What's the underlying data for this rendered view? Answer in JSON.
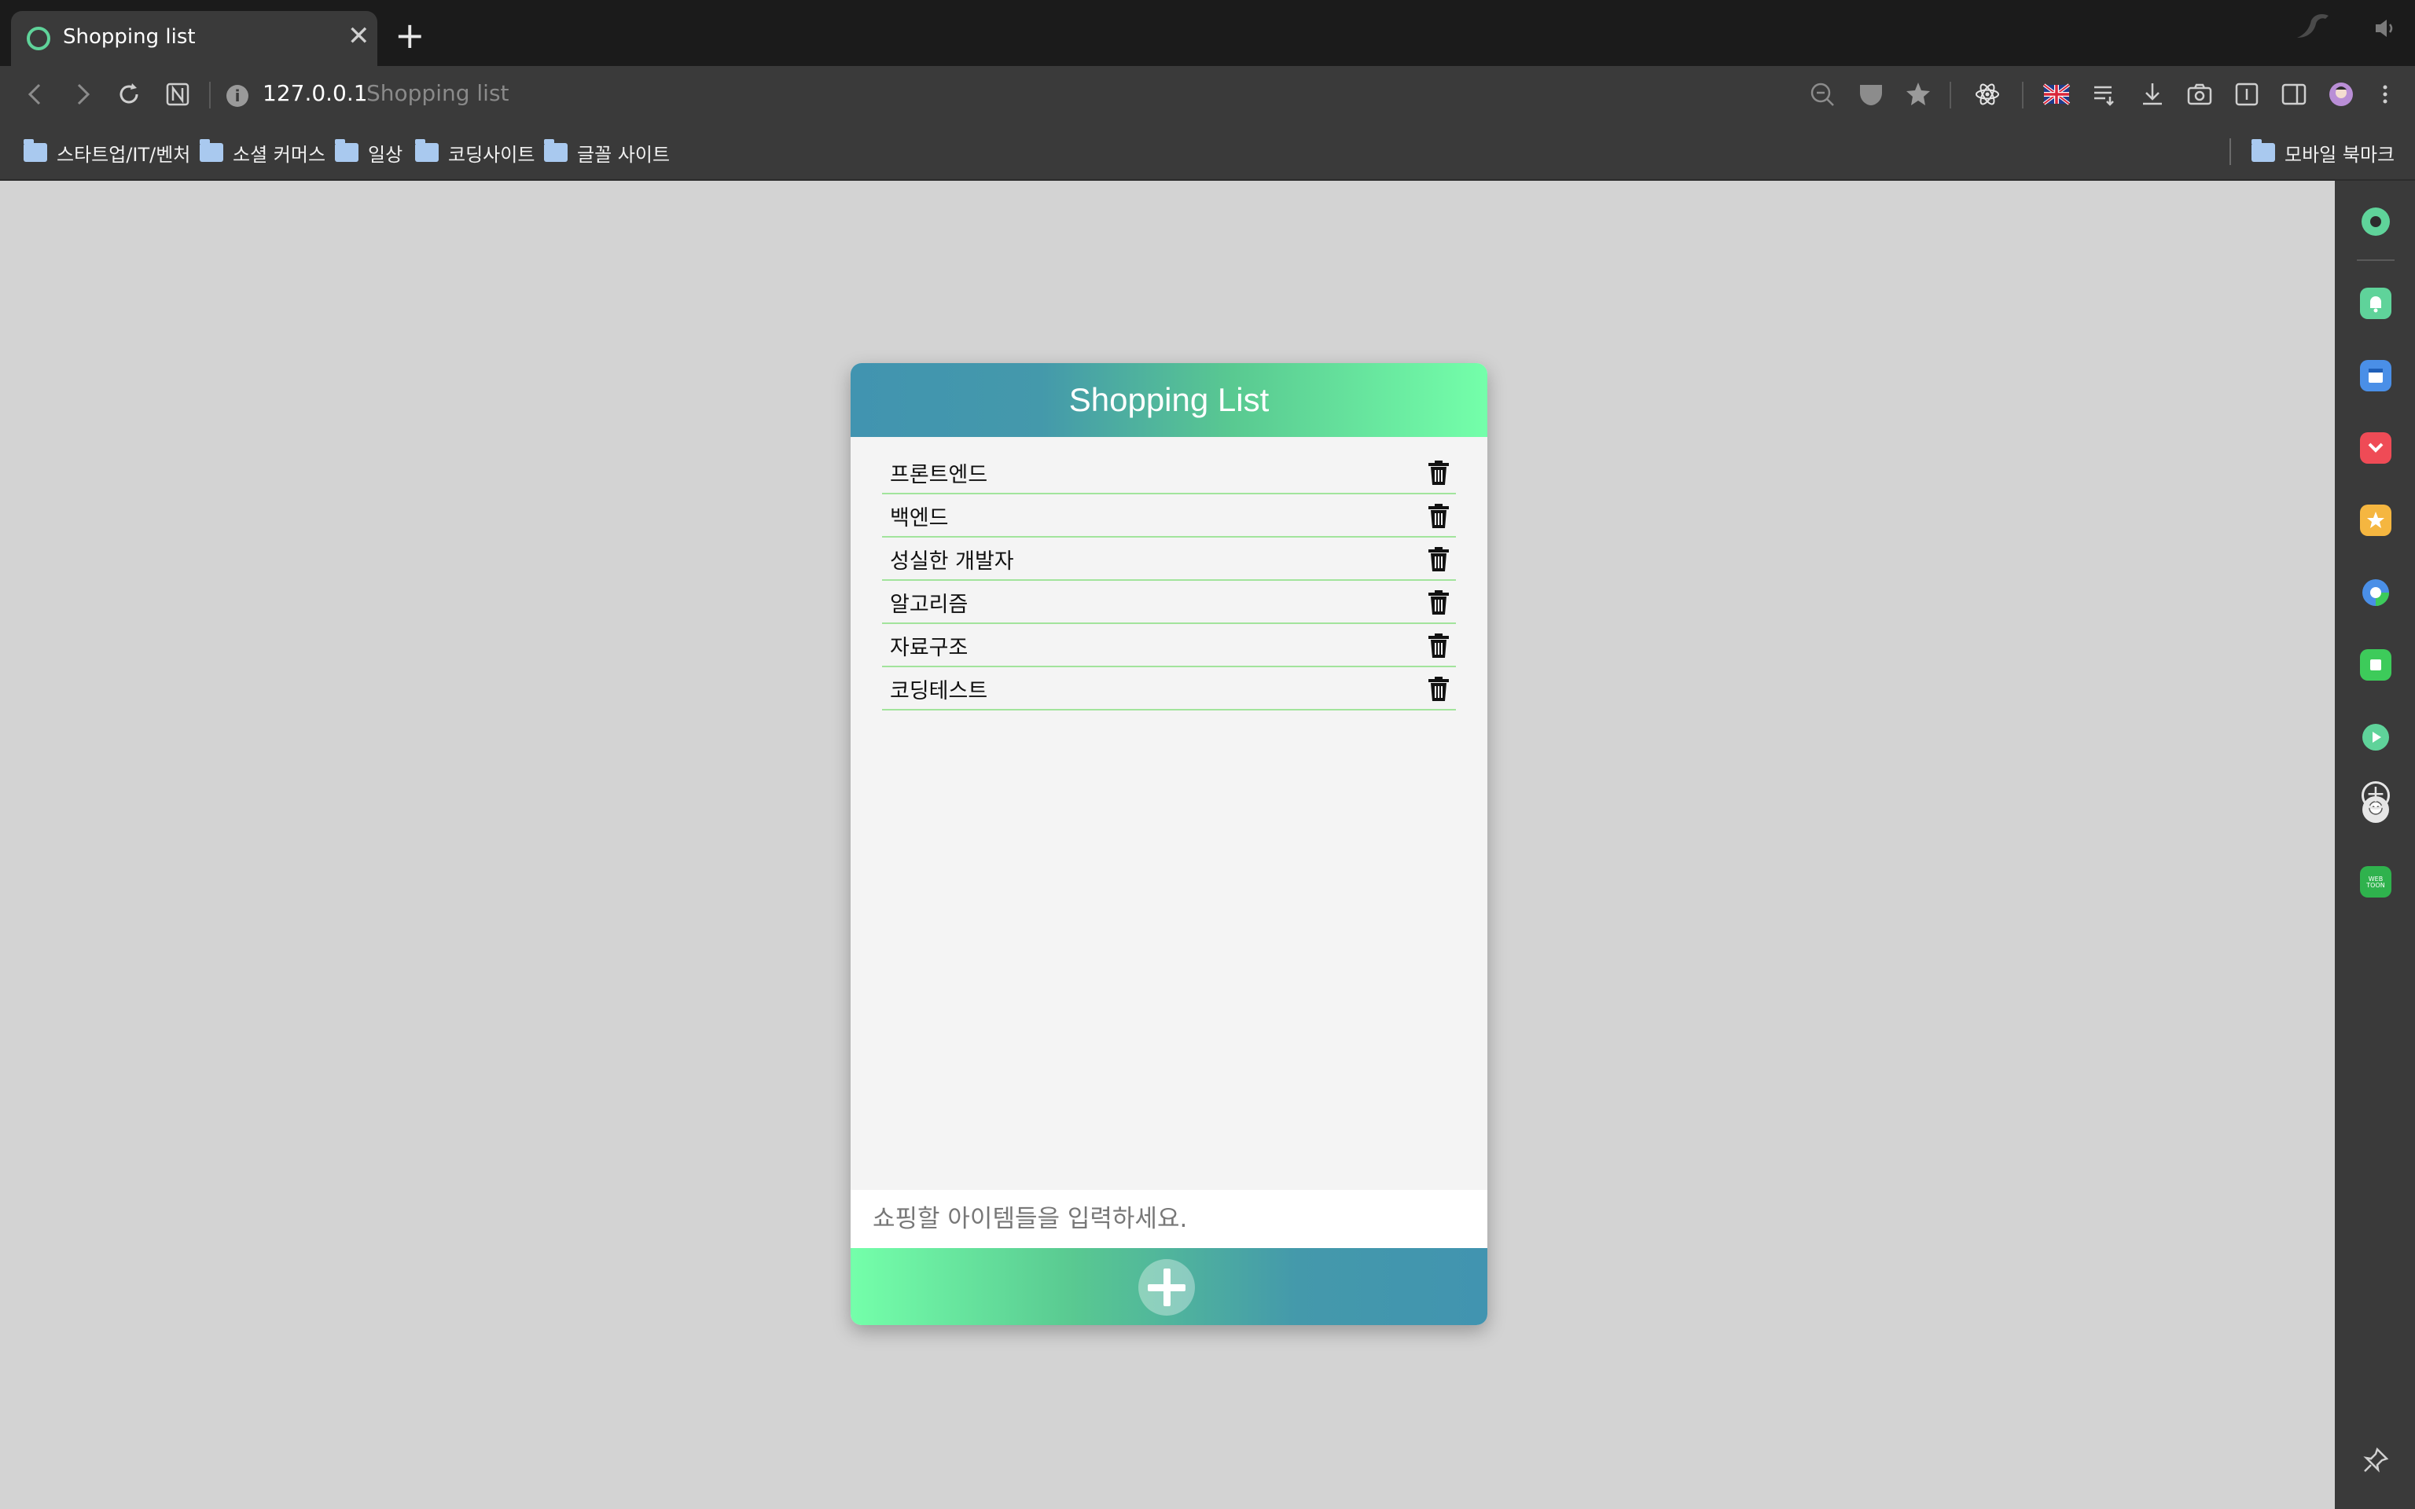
{
  "browser": {
    "tab": {
      "title": "Shopping list",
      "close_glyph": "✕"
    },
    "new_tab_glyph": "+",
    "address": {
      "url": "127.0.0.1",
      "page_title": "Shopping list",
      "info_glyph": "i"
    },
    "bookmarks": [
      {
        "label": "스타트업/IT/벤처"
      },
      {
        "label": "소셜 커머스"
      },
      {
        "label": "일상"
      },
      {
        "label": "코딩사이트"
      },
      {
        "label": "글꼴 사이트"
      }
    ],
    "bookmarks_right": {
      "label": "모바일 북마크"
    }
  },
  "sidebar": {
    "icons": [
      {
        "name": "sidebar-green-circle-icon",
        "color": "#5fd39a"
      },
      {
        "name": "sidebar-notification-icon",
        "color": "#5fd39a"
      },
      {
        "name": "sidebar-calendar-icon",
        "color": "#4a8fe7"
      },
      {
        "name": "sidebar-pocket-icon",
        "color": "#ef4b56"
      },
      {
        "name": "sidebar-star-icon",
        "color": "#f5b640"
      },
      {
        "name": "sidebar-chrome-icon",
        "color": "#4a8fe7"
      },
      {
        "name": "sidebar-green-square-icon",
        "color": "#3dcb5a"
      },
      {
        "name": "sidebar-play-icon",
        "color": "#5fd39a"
      },
      {
        "name": "sidebar-avatar-icon",
        "color": "#d9d9d9"
      },
      {
        "name": "sidebar-webtoon-icon",
        "color": "#2fb24d"
      }
    ],
    "add_glyph": "+",
    "pin_glyph": "📌"
  },
  "app": {
    "title": "Shopping List",
    "items": [
      {
        "name": "프론트엔드"
      },
      {
        "name": "백엔드"
      },
      {
        "name": "성실한 개발자"
      },
      {
        "name": "알고리즘"
      },
      {
        "name": "자료구조"
      },
      {
        "name": "코딩테스트"
      }
    ],
    "input_placeholder": "쇼핑할 아이템들을 입력하세요.",
    "colors": {
      "header_start": "#4194b0",
      "header_end": "#74ffaa",
      "divider": "#a2e49c"
    }
  }
}
